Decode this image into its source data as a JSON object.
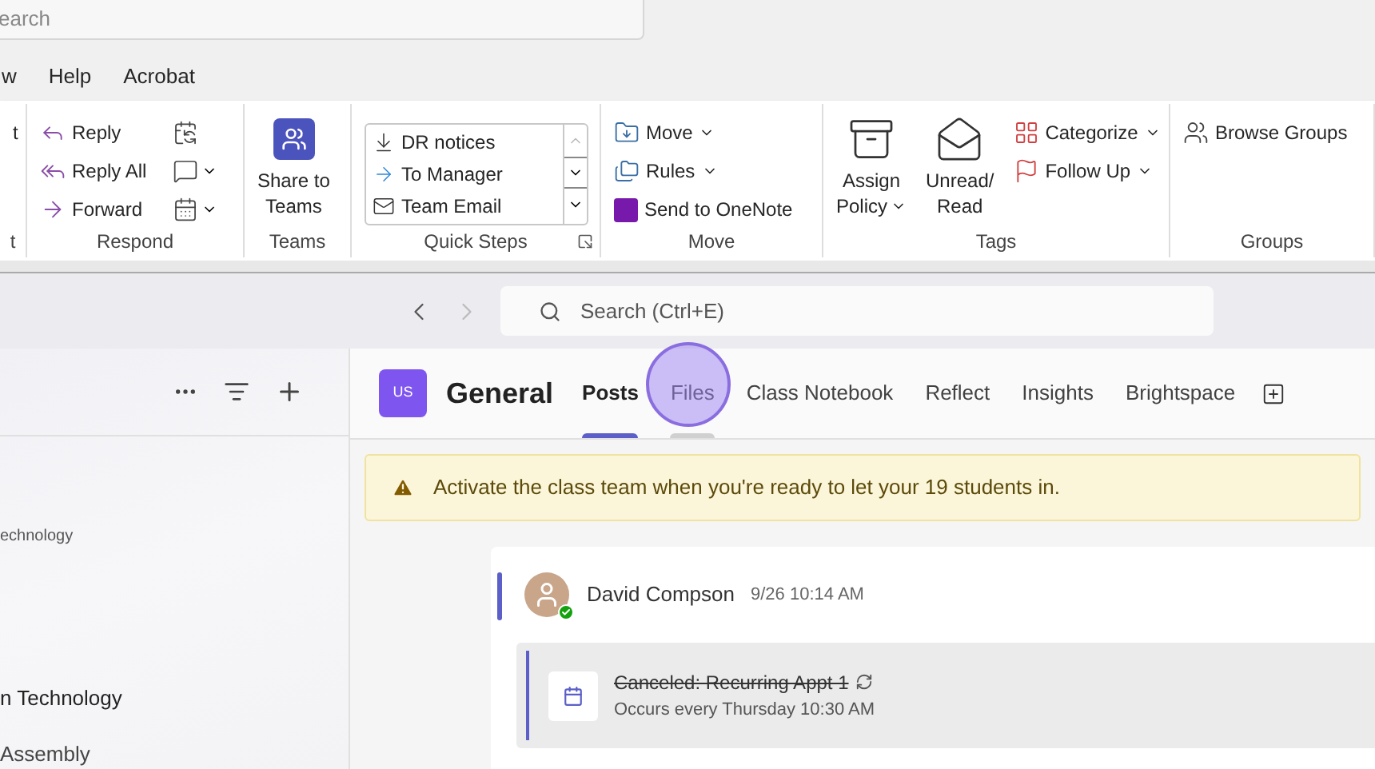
{
  "outlook": {
    "search": {
      "placeholder": "earch"
    },
    "menu": [
      "w",
      "Help",
      "Acrobat"
    ],
    "ribbon": [
      {
        "label": "t",
        "items": [
          {
            "kind": "small",
            "text": "t"
          }
        ]
      },
      {
        "label": "Respond",
        "items": [
          {
            "kind": "small",
            "text": "Reply"
          },
          {
            "kind": "small",
            "text": "Reply All"
          },
          {
            "kind": "small",
            "text": "Forward"
          }
        ]
      },
      {
        "label": "Teams",
        "items": [
          {
            "kind": "large",
            "lines": [
              "Share to",
              "Teams"
            ]
          }
        ]
      },
      {
        "label": "Quick Steps",
        "items": [
          {
            "kind": "quickstep",
            "text": "DR notices"
          },
          {
            "kind": "quickstep",
            "text": "To Manager"
          },
          {
            "kind": "quickstep",
            "text": "Team Email"
          }
        ]
      },
      {
        "label": "Move",
        "items": [
          {
            "kind": "dropdown",
            "text": "Move"
          },
          {
            "kind": "dropdown",
            "text": "Rules"
          },
          {
            "kind": "small",
            "text": "Send to OneNote"
          }
        ]
      },
      {
        "label": "Tags",
        "items": [
          {
            "kind": "large-dropdown",
            "lines": [
              "Assign",
              "Policy"
            ]
          },
          {
            "kind": "large",
            "lines": [
              "Unread/",
              "Read"
            ]
          },
          {
            "kind": "dropdown",
            "text": "Categorize"
          },
          {
            "kind": "dropdown",
            "text": "Follow Up"
          }
        ]
      },
      {
        "label": "Groups",
        "items": [
          {
            "kind": "small",
            "text": "Browse Groups"
          }
        ]
      }
    ]
  },
  "teams": {
    "search": {
      "placeholder": "Search (Ctrl+E)"
    },
    "sidebar": [
      {
        "kind": "subtitle",
        "text": "echnology"
      },
      {
        "kind": "team",
        "text": "n Technology"
      },
      {
        "kind": "channel",
        "text": "Assembly"
      }
    ],
    "channel": {
      "avatar": "US",
      "title": "General",
      "tabs": [
        {
          "label": "Posts",
          "selected": true,
          "hovered": false
        },
        {
          "label": "Files",
          "selected": false,
          "hovered": true
        },
        {
          "label": "Class Notebook",
          "selected": false,
          "hovered": false
        },
        {
          "label": "Reflect",
          "selected": false,
          "hovered": false
        },
        {
          "label": "Insights",
          "selected": false,
          "hovered": false
        },
        {
          "label": "Brightspace",
          "selected": false,
          "hovered": false
        }
      ]
    },
    "banner": "Activate the class team when you're ready to let your 19 students in.",
    "post": {
      "author": "David Compson",
      "time": "9/26 10:14 AM",
      "online": true,
      "meeting": {
        "title": "Canceled: Recurring Appt 1",
        "canceled": true,
        "recurring": true,
        "schedule": "Occurs every Thursday 10:30 AM"
      }
    }
  }
}
